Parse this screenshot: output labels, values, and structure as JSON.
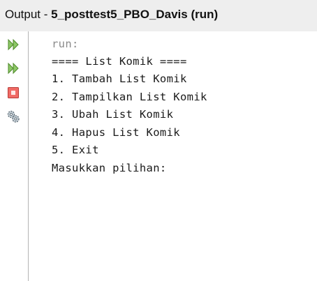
{
  "window": {
    "title_prefix": "Output - ",
    "title_bold": "5_posttest5_PBO_Davis (run)"
  },
  "toolbar": [
    {
      "name": "rerun-icon",
      "color": "#6dae3e"
    },
    {
      "name": "rerun-with-options-icon",
      "color": "#6dae3e"
    },
    {
      "name": "stop-icon",
      "color": "#e05a55"
    },
    {
      "name": "settings-icon",
      "color": "#7a8a96"
    }
  ],
  "console": {
    "lines": [
      "run:",
      "==== List Komik ====",
      "1. Tambah List Komik",
      "2. Tampilkan List Komik",
      "3. Ubah List Komik",
      "4. Hapus List Komik",
      "5. Exit",
      "Masukkan pilihan:"
    ]
  }
}
